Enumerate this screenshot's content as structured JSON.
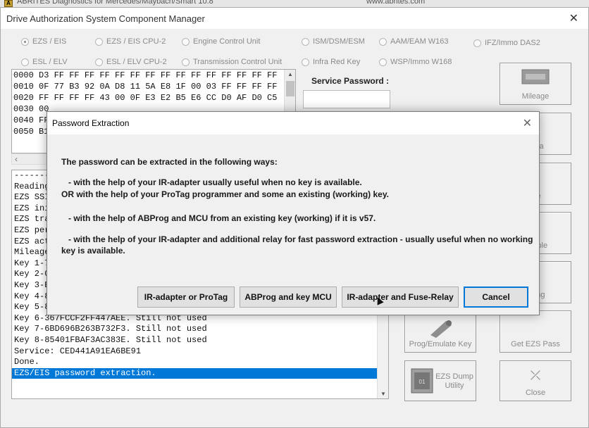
{
  "background_window": {
    "app_title_partial": "ABRITES Diagnostics for Mercedes/Maybach/Smart 10.8",
    "site_partial": "www.abrites.com"
  },
  "main_window": {
    "title": "Drive Authorization System Component Manager",
    "close_glyph": "✕"
  },
  "radios": [
    {
      "label": "EZS / EIS",
      "checked": true
    },
    {
      "label": "EZS / EIS CPU-2",
      "checked": false
    },
    {
      "label": "Engine Control Unit",
      "checked": false
    },
    {
      "label": "ISM/DSM/ESM",
      "checked": false
    },
    {
      "label": "AAM/EAM W163",
      "checked": false
    },
    {
      "label": "IFZ/Immo DAS2",
      "checked": false
    },
    {
      "label": "ESL / ELV",
      "checked": false
    },
    {
      "label": "ESL / ELV CPU-2",
      "checked": false
    },
    {
      "label": "Transmission Control Unit",
      "checked": false
    },
    {
      "label": "Infra Red Key",
      "checked": false
    },
    {
      "label": "WSP/Immo W168",
      "checked": false
    }
  ],
  "hex_dump": [
    "0000 D3 FF FF FF FF FF FF FF FF FF FF FF FF FF FF FF",
    "0010 0F 77 B3 92 0A D8 11 5A E8 1F 00 03 FF FF FF FF",
    "0020 FF FF FF FF 43 00 0F E3 E2 B5 E6 CC D0 AF D0 C5",
    "0030 00",
    "0040 FF",
    "0050 B1"
  ],
  "service_password": {
    "label": "Service Password :",
    "value": ""
  },
  "log_lines": [
    "----------",
    "Reading",
    "EZS SSI",
    "EZS ini",
    "EZS tra",
    "EZS per",
    "EZS act",
    "Mileage",
    "Key 1-7",
    "Key 2-0",
    "Key 3-E",
    "Key 4-8",
    "Key 5-8",
    "Key 6-367FCCF2FF447AEE. Still not used",
    "Key 7-6BD696B263B732F3. Still not used",
    "Key 8-85401FBAF3AC383E. Still not used",
    "Service: CED441A91EA6BE91",
    "Done.",
    "EZS/EIS password extraction."
  ],
  "tiles": [
    {
      "label": "Mileage",
      "icon": "odometer-icon"
    },
    {
      "label": "Data",
      "icon": "data-icon"
    },
    {
      "label": "ate",
      "icon": "update-icon"
    },
    {
      "label": "Enable",
      "icon": "enable-icon"
    },
    {
      "label": "oding",
      "icon": "coding-icon"
    },
    {
      "label": "Prog/Emulate Key",
      "icon": "key-icon"
    },
    {
      "label": "Get EZS Pass",
      "icon": "pass-icon"
    },
    {
      "label": "EZS Dump Utility",
      "icon": "chip-icon"
    },
    {
      "label": "Close",
      "icon": "close-icon"
    }
  ],
  "dialog": {
    "title": "Password Extraction",
    "close_glyph": "✕",
    "lines": [
      "The password can be extracted in the following ways:",
      "   - with the help of your IR-adapter usually useful when no key is available.",
      "OR with the help of your ProTag programmer and some an existing (working) key.",
      "   - with the help of ABProg and MCU from an existing key (working) if it is v57.",
      "   - with the help of your IR-adapter and additional relay for fast password extraction - usually useful when no working",
      "key is available."
    ],
    "buttons": {
      "ir_protag": "IR-adapter or ProTag",
      "abprog": "ABProg and key MCU",
      "ir_fuse": "IR-adapter and Fuse-Relay",
      "cancel": "Cancel"
    }
  }
}
